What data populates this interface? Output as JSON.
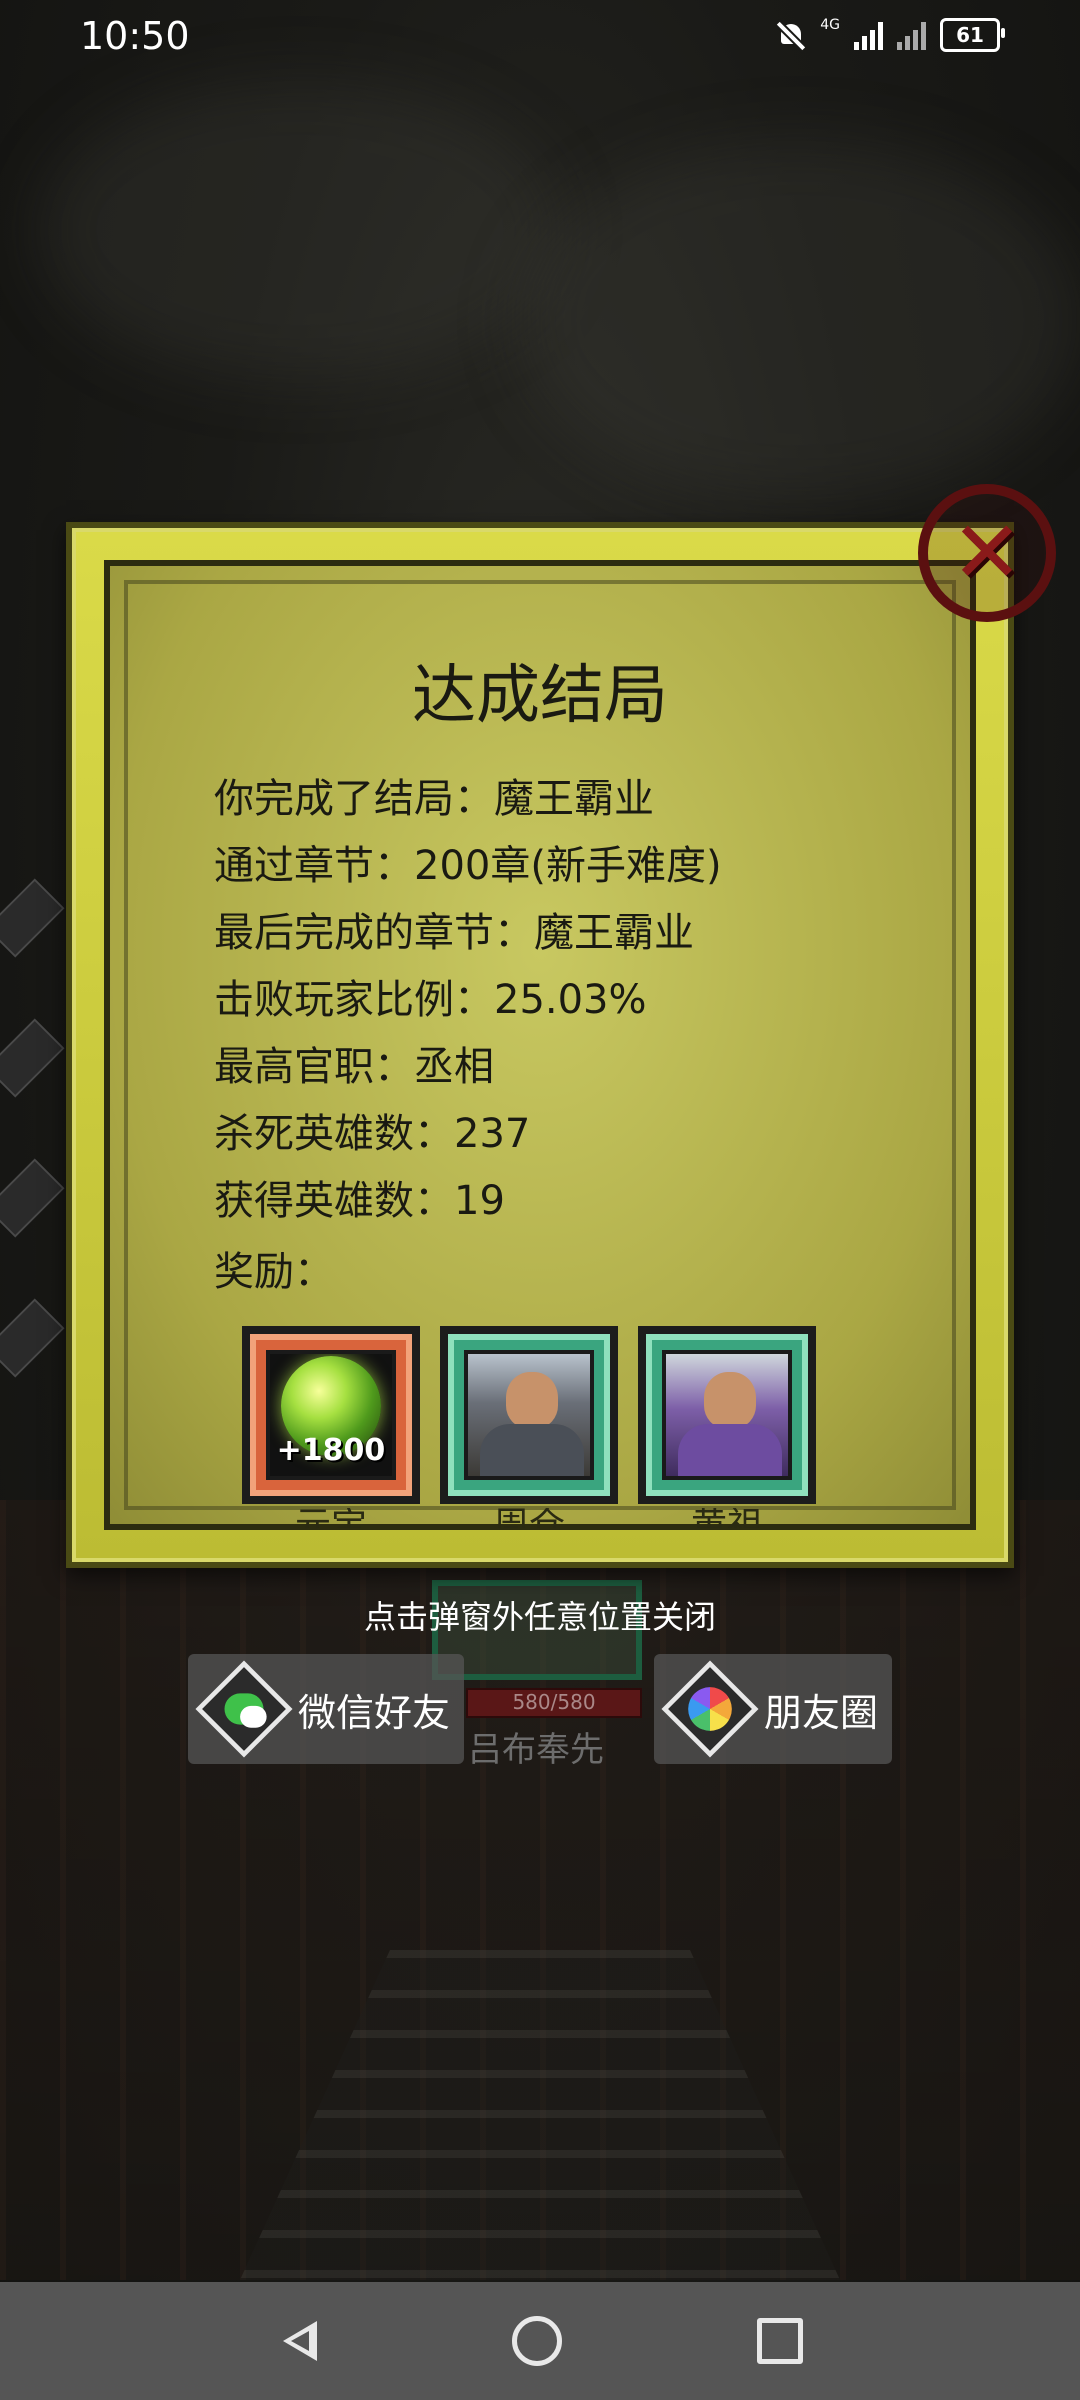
{
  "status_bar": {
    "time": "10:50",
    "network_label": "4G",
    "battery": "61"
  },
  "dialog": {
    "title": "达成结局",
    "stats": [
      "你完成了结局：魔王霸业",
      "通过章节：200章(新手难度)",
      "最后完成的章节：魔王霸业",
      "击败玩家比例：25.03%",
      "最高官职：丞相",
      "杀死英雄数：237",
      "获得英雄数：19"
    ],
    "rewards_label": "奖励：",
    "rewards": [
      {
        "type": "gem",
        "amount": "+1800",
        "caption": "元宝",
        "frame_color": "#d9643c"
      },
      {
        "type": "hero",
        "amount": "",
        "caption": "周仓",
        "frame_color": "#3aa57f"
      },
      {
        "type": "hero",
        "amount": "",
        "caption": "黄祖",
        "frame_color": "#3aa57f"
      }
    ],
    "close_icon": "close-icon"
  },
  "hint": "点击弹窗外任意位置关闭",
  "background": {
    "hp": "580/580",
    "name": "吕布奉先"
  },
  "share": {
    "wechat_label": "微信好友",
    "moments_label": "朋友圈"
  },
  "nav": {
    "back_icon": "back-triangle-icon",
    "home_icon": "home-circle-icon",
    "recent_icon": "recent-square-icon"
  }
}
